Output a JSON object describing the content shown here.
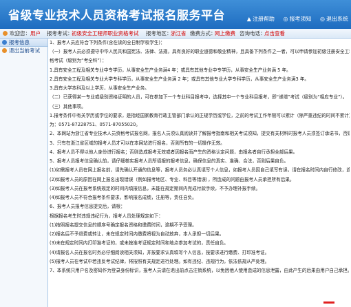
{
  "header": {
    "title": "省级专业技术人员资格考试报名服务平台",
    "links": [
      {
        "icon": "▲",
        "label": "注册帮助"
      },
      {
        "icon": "◎",
        "label": "报考须知"
      },
      {
        "icon": "◎",
        "label": "退出系统"
      }
    ]
  },
  "infobar": {
    "welcome": "欢迎您：",
    "user": "用户",
    "exam_label": "报考考试：",
    "exam_value": "初级安全工程师职业资格考试",
    "area_label": "报考地区：",
    "area_value": "浙江省",
    "mode_label": "缴费方式：",
    "mode_value": "网上缴费",
    "phone_label": "咨询电话：",
    "phone_link": "点击查看"
  },
  "sidebar": {
    "header": "报考信息",
    "items": [
      {
        "label": "退出当前考试"
      }
    ]
  },
  "content": {
    "lines": [
      "1、报考人员应符合下列条件(含在读的全日制学校学生)：",
      "（一）报考人员必须遵守中华人民共和国宪法、法律、法规，具有良好的职业道德和敬业精神，且具备下列条件之一者，可以申请参加初级注册安全工程师职业资",
      "格考试（级别为“考全科”）：",
      "1.具有安全工程及相关专业中专学历，从事安全生产业务满4 年；或具有其他专业中专学历，从事安全生产业务满 5 年。",
      "2.具有安全工程及相关专业大学专科学历，从事安全生产业务满 2 年；或具有其他专业大学专科学历，从事安全生产业务满3 年。",
      "3.具有大学本科及以上学历，从事安全生产业务。",
      "（二）已获得某一专业或级别资格证明的人员，可在参加下一个专业科目报考中，选择其中一个专业科目报考，即“递增”考试（级别为“相应专业”）。",
      "（三）其他事项。",
      "1.报考条件中有关学历或学位的要求，是指经国家教育行政主管部门承认的正规学历或学位，之前的考试工作年限可以累计（除严重违纪的时间不累计），报考条件咨询电话",
      "为：0571-87228751、0571-87055020。",
      "2、本网站为浙江省专业技术人员资格考试报名网，报名人员须认真阅读并了解报考指南和相关考试须知，提交有关材料时报考人员须签订承诺书，否则不予审核。",
      "3、只有在浙江省区域的报考人员才可以在本网站进行报名，否则所有的一切操作无效。",
      "4、报考人员不得以他人身份进行报名；否则造成报考无效或者因报名而产生的资格认定问题，由报名者自行承担全部后果。",
      "5、报考人员报考信息确认前，请仔细核实报考人员所填报的报考信息，确保信息的真实、准确、合法，否则后果自负。",
      "(1)如需报考人员在网上报名前，请先确认开通的信息等，报考人员务必认真填写个人信息，如报考人员因自己填写有误，请在报名时间内自行修改，逾期不予受理后果自负。",
      "(2)如报考人员的原因在网上报名出现错误（例如报考地区、专业、科目等错误），所造成的问题由报考人员承担所有后果。",
      "(3)如报考人员在报考系统规定的时间内填报信息，未能在规定期间内完成付款手续，不予办理补报手续。",
      "(4)如报考人员不符合报考条件要求，影响报名成绩，注册等，责任自负。",
      "6、报考人员报考信息提交后，请根：",
      "根据报名考生时违规违纪行为，报考人员处理规定如下：",
      "(1)按照报名提交信息的顺序号确定报名资格和缴费时间，逾期不予受理。",
      "(2)报名后不予退费或转让，未在规定时间内缴费将视为自动放弃，本人承担一切后果。",
      "(3)未在规定时间内打印准考证的，或未按准考证规定时间和地点参加考试的，责任自负。",
      "(4)请报名人员在报名时务必仔细阅读相关须知，并按要求认真填写个人信息，按要求进行缴费、打印准考证。",
      "(5)报考人员在考试中若违反考试纪律，将按照有关规定进行处理。如有违纪、违规行为，依法依规从严处理。",
      "7、本系统只用户名及密码作为登录身份标识，报考人员请在退出前点击注销系统，以免因他人使用造成的信息泄露，由此产生的后果由用户自己承担。"
    ]
  }
}
